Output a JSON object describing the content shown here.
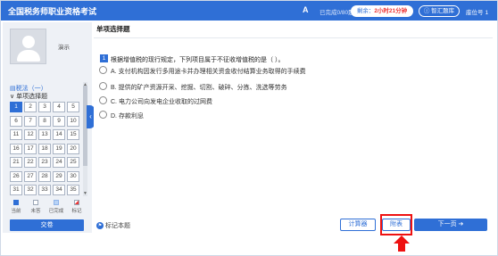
{
  "header": {
    "title": "全国税务师职业资格考试",
    "font_icon": "A",
    "answered": "已完成0/80题",
    "timer_label": "剩余：",
    "timer_value": "2小时21分钟",
    "tip_button": "智汇题库",
    "seat_label": "座位号",
    "seat_value": "1"
  },
  "sidebar": {
    "user_name": "演示",
    "subject": "税法（一）",
    "section": "单项选择题",
    "numbers": [
      "1",
      "2",
      "3",
      "4",
      "5",
      "6",
      "7",
      "8",
      "9",
      "10",
      "11",
      "12",
      "13",
      "14",
      "15",
      "16",
      "17",
      "18",
      "19",
      "20",
      "21",
      "22",
      "23",
      "24",
      "25",
      "26",
      "27",
      "28",
      "29",
      "30",
      "31",
      "32",
      "33",
      "34",
      "35"
    ],
    "current": "1",
    "legend": [
      "当前",
      "未答",
      "已完成",
      "标记"
    ],
    "submit_label": "交卷"
  },
  "question": {
    "type_title": "单项选择题",
    "number": "1",
    "text": "根据增值税的现行规定，下列项目属于不征收增值税的是（ ）。",
    "options": [
      {
        "label": "A.",
        "text": "支付机构因发行多用途卡并办理相关资金收付结算业务取得的手续费"
      },
      {
        "label": "B.",
        "text": "提供的矿产资源开采、挖掘、切割、破碎、分拣、洗选等劳务"
      },
      {
        "label": "C.",
        "text": "电力公司向发电企业收取的过网费"
      },
      {
        "label": "D.",
        "text": "存款利息"
      }
    ]
  },
  "footer": {
    "mark_label": "标记本题",
    "calculator_label": "计算器",
    "attachment_label": "附表",
    "next_label": "下一页"
  },
  "colors": {
    "accent": "#2f6fd6",
    "highlight": "#e11111"
  }
}
